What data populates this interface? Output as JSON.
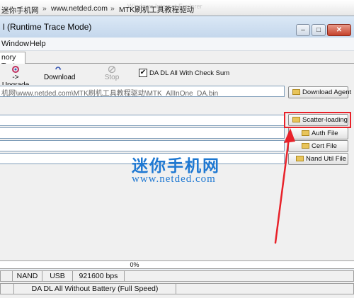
{
  "browser": {
    "faded_tabs": [
      "…",
      "Windows Internet Explorer"
    ],
    "breadcrumbs": [
      "迷你手机网",
      "www.netded.com",
      "MTK刷机工具教程驱动"
    ],
    "separator": "»"
  },
  "window": {
    "title": "l (Runtime Trace Mode)",
    "buttons": [
      "–",
      "□",
      "✕"
    ]
  },
  "menu": {
    "items": [
      "Window",
      "Help"
    ]
  },
  "tabs": [
    "nory Test"
  ],
  "toolbar": {
    "upgrade_label": "-> Upgrade",
    "download_label": "Download",
    "stop_label": "Stop",
    "checkbox_checked": true,
    "checkbox_label": "DA DL All With Check Sum"
  },
  "files": {
    "da_path": "机网\\www.netded.com\\MTK刷机工具教程驱动\\MTK_AllInOne_DA.bin"
  },
  "side_buttons": [
    "Download Agent",
    "Scatter-loading",
    "Auth File",
    "Cert File",
    "Nand Util File"
  ],
  "watermark": {
    "title": "迷你手机网",
    "url": "www.netded.com"
  },
  "progress": {
    "text": "0%",
    "percent": 0
  },
  "status": {
    "row1": [
      "NAND",
      "USB",
      "921600 bps"
    ],
    "row2": "DA DL All Without Battery (Full Speed)"
  },
  "colors": {
    "accent": "#1e78d2",
    "highlight": "#e8222a"
  }
}
